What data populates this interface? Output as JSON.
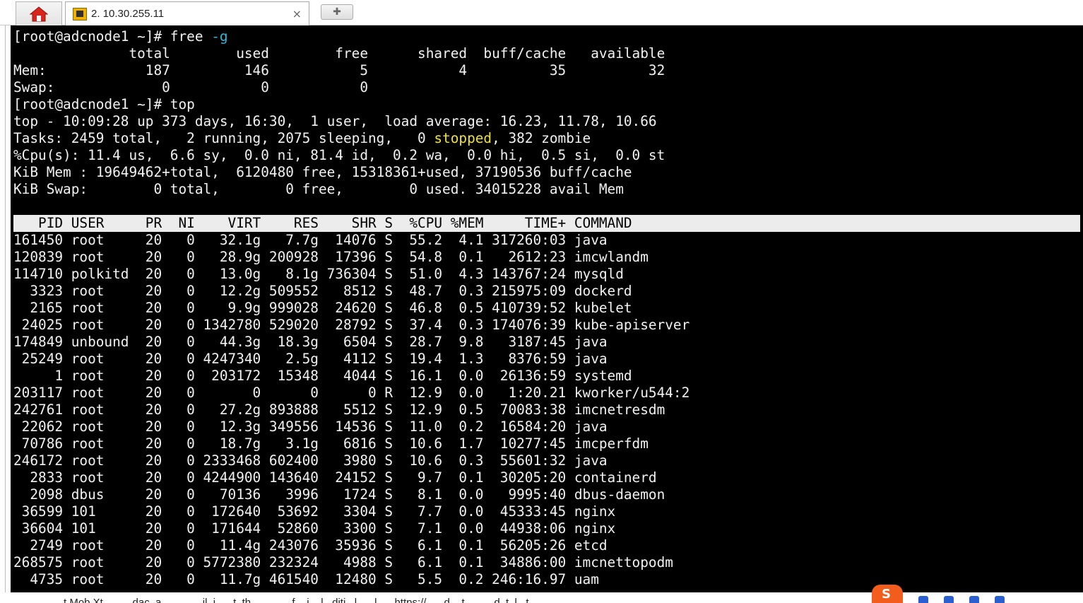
{
  "tabs": {
    "home_icon": "home-icon",
    "session_title": "2. 10.30.255.11",
    "close_glyph": "×",
    "new_tab_glyph": "✚"
  },
  "terminal": {
    "free_prompt": "[root@adcnode1 ~]# free ",
    "free_flag": "-g",
    "free_header": "              total        used        free      shared  buff/cache   available",
    "free_mem": "Mem:            187         146           5           4          35          32",
    "free_swap": "Swap:             0           0           0",
    "top_prompt": "[root@adcnode1 ~]# top",
    "top_summary": "top - 10:09:28 up 373 days, 16:30,  1 user,  load average: 16.23, 11.78, 10.66",
    "tasks_before": "Tasks: 2459 total,   2 running, 2075 sleeping,   0 ",
    "tasks_stopped": "stopped",
    "tasks_after": ", 382 zombie",
    "cpu": "%Cpu(s): 11.4 us,  6.6 sy,  0.0 ni, 81.4 id,  0.2 wa,  0.0 hi,  0.5 si,  0.0 st",
    "kib_mem": "KiB Mem : 19649462+total,  6120480 free, 15318361+used, 37190536 buff/cache",
    "kib_swap": "KiB Swap:        0 total,        0 free,        0 used. 34015228 avail Mem",
    "columns": [
      "PID",
      "USER",
      "PR",
      "NI",
      "VIRT",
      "RES",
      "SHR",
      "S",
      "%CPU",
      "%MEM",
      "TIME+",
      "COMMAND"
    ],
    "processes": [
      [
        "161450",
        "root",
        "20",
        "0",
        "32.1g",
        "7.7g",
        "14076",
        "S",
        "55.2",
        "4.1",
        "317260:03",
        "java"
      ],
      [
        "120839",
        "root",
        "20",
        "0",
        "28.9g",
        "200928",
        "17396",
        "S",
        "54.8",
        "0.1",
        "2612:23",
        "imcwlandm"
      ],
      [
        "114710",
        "polkitd",
        "20",
        "0",
        "13.0g",
        "8.1g",
        "736304",
        "S",
        "51.0",
        "4.3",
        "143767:24",
        "mysqld"
      ],
      [
        "3323",
        "root",
        "20",
        "0",
        "12.2g",
        "509552",
        "8512",
        "S",
        "48.7",
        "0.3",
        "215975:09",
        "dockerd"
      ],
      [
        "2165",
        "root",
        "20",
        "0",
        "9.9g",
        "999028",
        "24620",
        "S",
        "46.8",
        "0.5",
        "410739:52",
        "kubelet"
      ],
      [
        "24025",
        "root",
        "20",
        "0",
        "1342780",
        "529020",
        "28792",
        "S",
        "37.4",
        "0.3",
        "174076:39",
        "kube-apiserver"
      ],
      [
        "174849",
        "unbound",
        "20",
        "0",
        "44.3g",
        "18.3g",
        "6504",
        "S",
        "28.7",
        "9.8",
        "3187:45",
        "java"
      ],
      [
        "25249",
        "root",
        "20",
        "0",
        "4247340",
        "2.5g",
        "4112",
        "S",
        "19.4",
        "1.3",
        "8376:59",
        "java"
      ],
      [
        "1",
        "root",
        "20",
        "0",
        "203172",
        "15348",
        "4044",
        "S",
        "16.1",
        "0.0",
        "26136:59",
        "systemd"
      ],
      [
        "203117",
        "root",
        "20",
        "0",
        "0",
        "0",
        "0",
        "R",
        "12.9",
        "0.0",
        "1:20.21",
        "kworker/u544:2"
      ],
      [
        "242761",
        "root",
        "20",
        "0",
        "27.2g",
        "893888",
        "5512",
        "S",
        "12.9",
        "0.5",
        "70083:38",
        "imcnetresdm"
      ],
      [
        "22062",
        "root",
        "20",
        "0",
        "12.3g",
        "349556",
        "14536",
        "S",
        "11.0",
        "0.2",
        "16584:20",
        "java"
      ],
      [
        "70786",
        "root",
        "20",
        "0",
        "18.7g",
        "3.1g",
        "6816",
        "S",
        "10.6",
        "1.7",
        "10277:45",
        "imcperfdm"
      ],
      [
        "246172",
        "root",
        "20",
        "0",
        "2333468",
        "602400",
        "3980",
        "S",
        "10.6",
        "0.3",
        "55601:32",
        "java"
      ],
      [
        "2833",
        "root",
        "20",
        "0",
        "4244900",
        "143640",
        "24152",
        "S",
        "9.7",
        "0.1",
        "30205:20",
        "containerd"
      ],
      [
        "2098",
        "dbus",
        "20",
        "0",
        "70136",
        "3996",
        "1724",
        "S",
        "8.1",
        "0.0",
        "9995:40",
        "dbus-daemon"
      ],
      [
        "36599",
        "101",
        "20",
        "0",
        "172640",
        "53692",
        "3304",
        "S",
        "7.7",
        "0.0",
        "45333:45",
        "nginx"
      ],
      [
        "36604",
        "101",
        "20",
        "0",
        "171644",
        "52860",
        "3300",
        "S",
        "7.1",
        "0.0",
        "44938:06",
        "nginx"
      ],
      [
        "2749",
        "root",
        "20",
        "0",
        "11.4g",
        "243076",
        "35936",
        "S",
        "6.1",
        "0.1",
        "56205:26",
        "etcd"
      ],
      [
        "268575",
        "root",
        "20",
        "0",
        "5772380",
        "232324",
        "4988",
        "S",
        "6.1",
        "0.1",
        "34886:00",
        "imcnettopodm"
      ],
      [
        "4735",
        "root",
        "20",
        "0",
        "11.7g",
        "461540",
        "12480",
        "S",
        "5.5",
        "0.2",
        "246:16.97",
        "uam"
      ]
    ]
  },
  "colors": {
    "terminal_bg": "#000000",
    "terminal_fg": "#f2f2f2",
    "flag_cyan": "#2fb9d9",
    "stopped_yellow": "#f0e13a",
    "header_row_bg": "#ececec"
  },
  "bottom_strip": {
    "text": "t Mob Xt          dac  a              il  i      t  th              f    i    l   diti   l      l      https://      d    t          d  t  l   t",
    "ime_icon": "sogou-ime-icon"
  }
}
